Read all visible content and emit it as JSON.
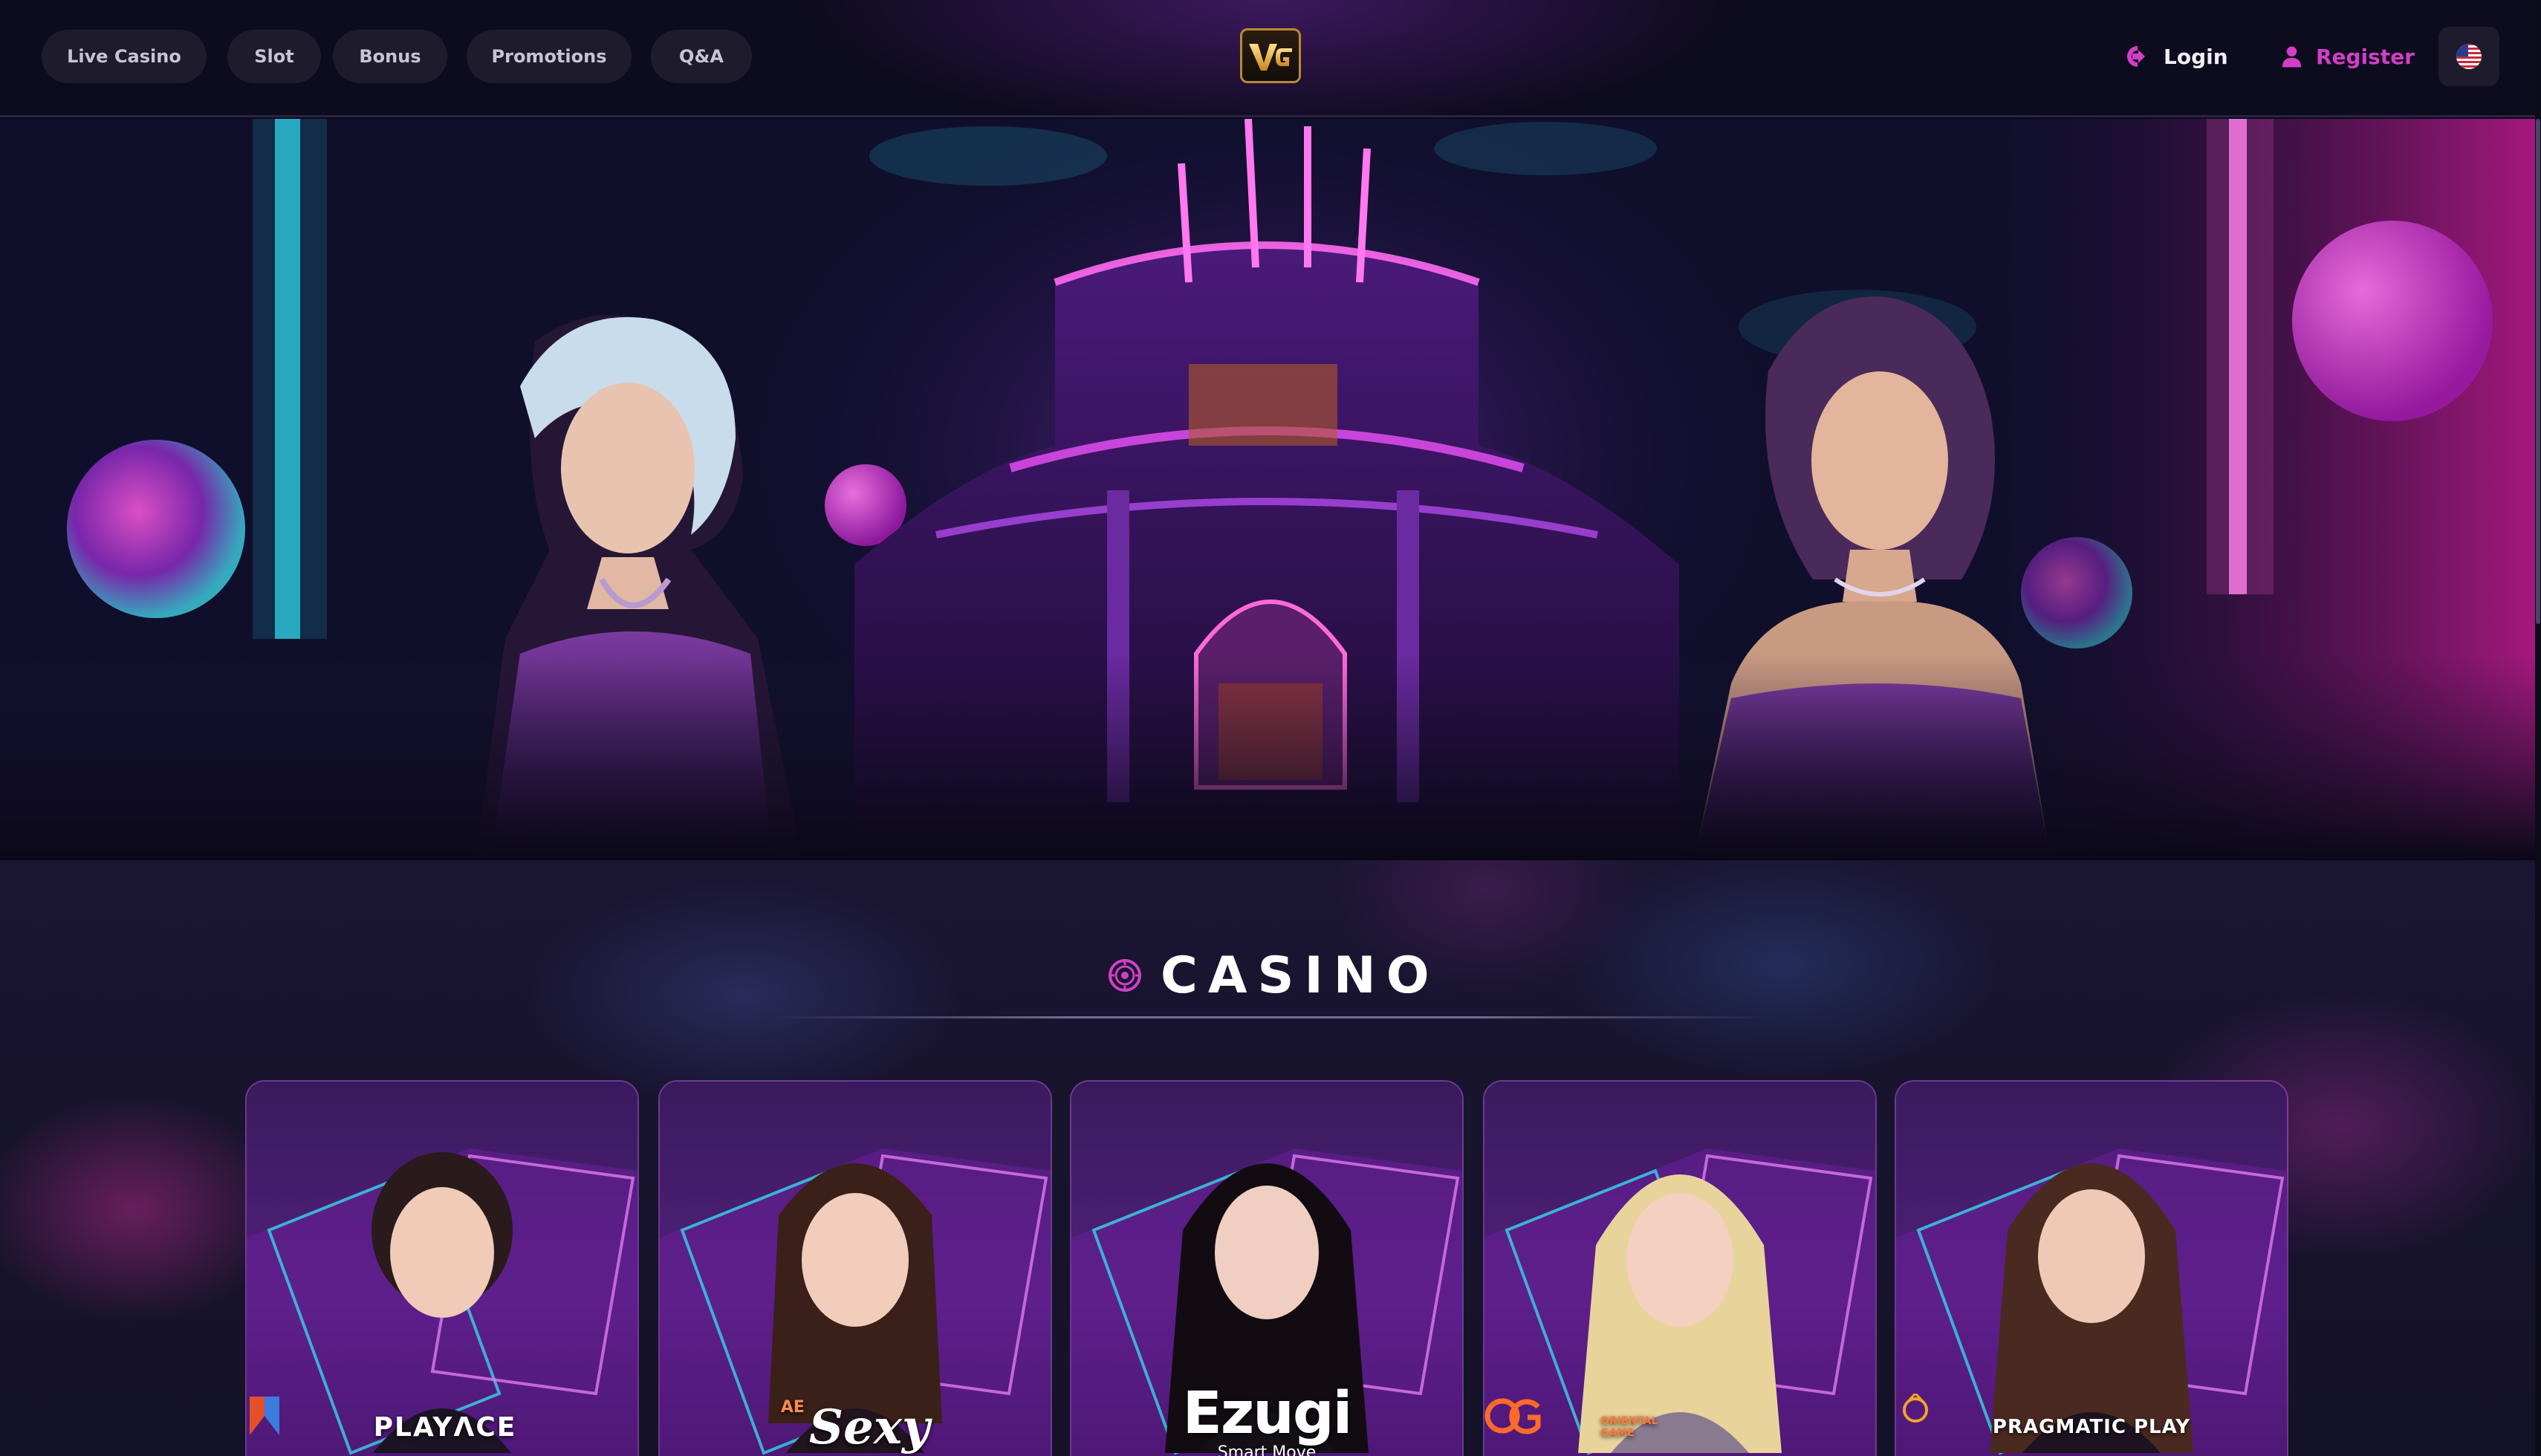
{
  "nav": {
    "items": [
      {
        "label": "Live Casino"
      },
      {
        "label": "Slot"
      },
      {
        "label": "Bonus"
      },
      {
        "label": "Promotions"
      },
      {
        "label": "Q&A"
      }
    ],
    "logo_text": "VG",
    "login_label": "Login",
    "register_label": "Register",
    "language_icon": "us-flag-icon"
  },
  "hero": {
    "slides_count": 2,
    "active_slide": 1
  },
  "casino": {
    "title": "CASINO",
    "title_icon": "chip-icon",
    "providers": [
      {
        "name": "PLAYACE",
        "logo": "PLAYΛCE"
      },
      {
        "name": "AE Sexy",
        "logo_top": "AE",
        "logo": "Sexy"
      },
      {
        "name": "Ezugi",
        "logo": "Ezugi",
        "tagline": "Smart Move"
      },
      {
        "name": "Oriental Game",
        "logo_top": "ORIENTAL",
        "logo": "GAME"
      },
      {
        "name": "Pragmatic Play",
        "logo": "PRAGMATIC PLAY"
      }
    ]
  },
  "colors": {
    "accent_pink": "#d23fc6",
    "accent_gold": "#e4a63a",
    "nav_bg": "#0d0b1e",
    "pill_bg": "#1e1c2c"
  }
}
